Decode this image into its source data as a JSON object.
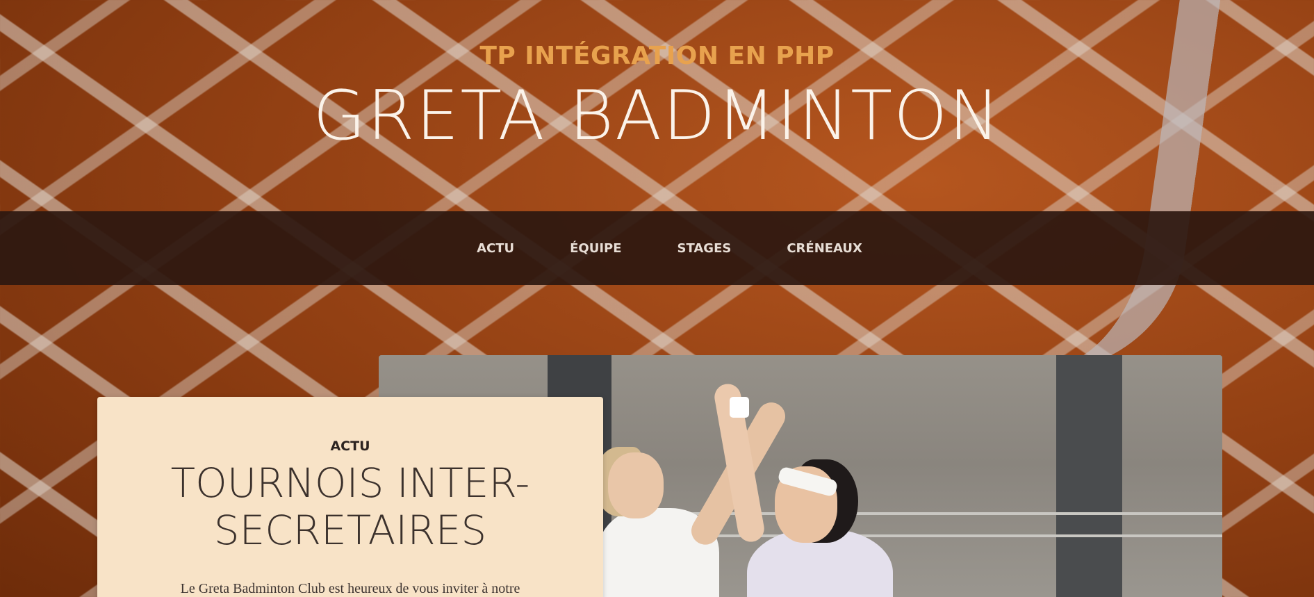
{
  "header": {
    "subtitle": "TP INTÉGRATION EN PHP",
    "title": "GRETA BADMINTON"
  },
  "nav": {
    "items": [
      {
        "label": "ACTU"
      },
      {
        "label": "ÉQUIPE"
      },
      {
        "label": "STAGES"
      },
      {
        "label": "CRÉNEAUX"
      }
    ]
  },
  "article": {
    "category": "ACTU",
    "title": "TOURNOIS INTER-SECRETAIRES",
    "excerpt": "Le Greta Badminton Club est heureux de vous inviter à notre"
  },
  "colors": {
    "accent": "#e8a24e",
    "nav_bg": "#2d1810",
    "card_bg": "#f8e3c7"
  }
}
